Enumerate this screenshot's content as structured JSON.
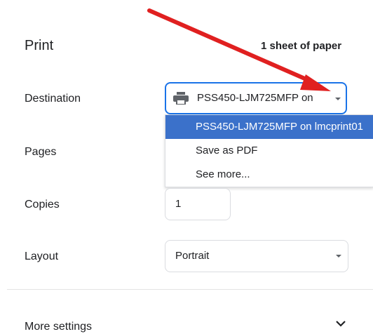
{
  "header": {
    "title": "Print",
    "sheet_count": "1 sheet of paper"
  },
  "destination": {
    "label": "Destination",
    "value": "PSS450-LJM725MFP on",
    "icon": "printer-icon",
    "options": [
      {
        "label": "PSS450-LJM725MFP on lmcprint01",
        "selected": true
      },
      {
        "label": "Save as PDF",
        "selected": false
      },
      {
        "label": "See more...",
        "selected": false
      }
    ]
  },
  "pages": {
    "label": "Pages"
  },
  "copies": {
    "label": "Copies",
    "value": "1"
  },
  "layout": {
    "label": "Layout",
    "value": "Portrait"
  },
  "more_settings": {
    "label": "More settings"
  },
  "colors": {
    "accent": "#1a73e8",
    "selected_bg": "#3b71ca",
    "annotation_arrow": "#e02020"
  }
}
